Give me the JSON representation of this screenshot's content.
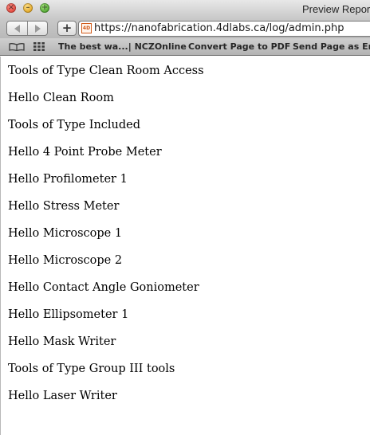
{
  "window": {
    "title": "Preview Repor"
  },
  "toolbar": {
    "back_icon": "back-arrow-icon",
    "forward_icon": "forward-arrow-icon",
    "add_label": "+",
    "favicon_text": "4D",
    "url": "https://nanofabrication.4dlabs.ca/log/admin.php"
  },
  "bookmarks": {
    "items": [
      {
        "label": "The best wa...| NCZOnline"
      },
      {
        "label": "Convert Page to PDF"
      },
      {
        "label": "Send Page as Em"
      }
    ]
  },
  "page": {
    "lines": [
      "Tools of Type Clean Room Access",
      "Hello Clean Room",
      "Tools of Type Included",
      "Hello 4 Point Probe Meter",
      "Hello Profilometer 1",
      "Hello Stress Meter",
      "Hello Microscope 1",
      "Hello Microscope 2",
      "Hello Contact Angle Goniometer",
      "Hello Ellipsometer 1",
      "Hello Mask Writer",
      "Tools of Type Group III tools",
      "Hello Laser Writer"
    ]
  }
}
